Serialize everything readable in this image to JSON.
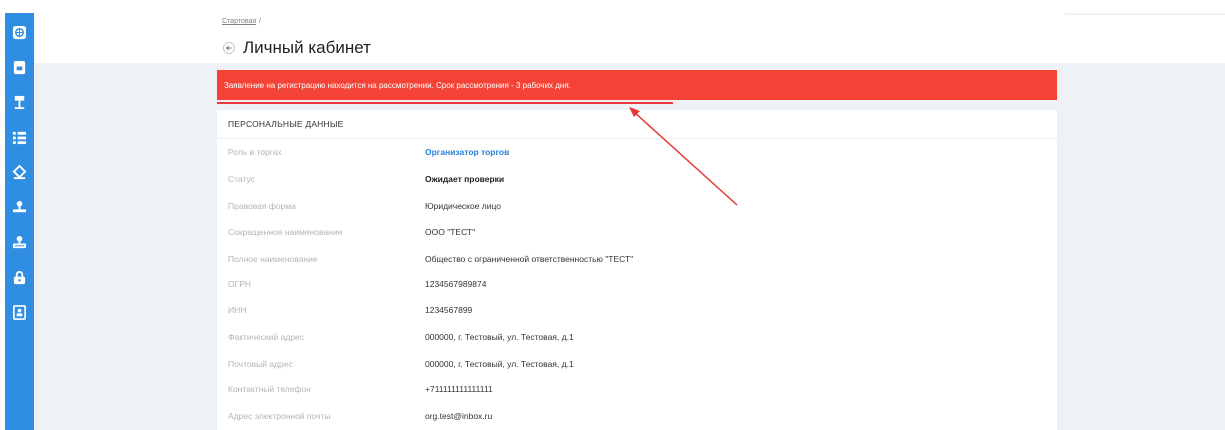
{
  "breadcrumb": {
    "home": "Стартовая",
    "separator": "/"
  },
  "page": {
    "title": "Личный кабинет"
  },
  "alert": {
    "text": "Заявление на регистрацию находится на рассмотрении. Срок рассмотрения - 3 рабочих дня.",
    "color": "#f44236"
  },
  "card": {
    "header": "ПЕРСОНАЛЬНЫЕ ДАННЫЕ",
    "rows": [
      {
        "label": "Роль в торгах",
        "value": "Организатор торгов"
      },
      {
        "label": "Статус",
        "value": "Ожидает проверки"
      },
      {
        "label": "Правовая форма",
        "value": "Юридическое лицо"
      },
      {
        "label": "Сокращенное наименование",
        "value": "ООО \"ТЕСТ\""
      },
      {
        "label": "Полное наименование",
        "value": "Общество с ограниченной ответственностью \"ТЕСТ\""
      },
      {
        "label": "ОГРН",
        "value": "1234567989874"
      },
      {
        "label": "ИНН",
        "value": "1234567899"
      },
      {
        "label": "Фактический адрес",
        "value": "000000, г. Тестовый, ул. Тестовая, д.1"
      },
      {
        "label": "Почтовый адрес",
        "value": "000000, г. Тестовый, ул. Тестовая, д.1"
      },
      {
        "label": "Контактный телефон",
        "value": "+711111111111111"
      },
      {
        "label": "Адрес электронной почты",
        "value": "org.test@inbox.ru"
      }
    ]
  },
  "sidebar": {
    "icons": [
      "globe-icon",
      "document-icon",
      "gavel-icon",
      "list-icon",
      "auction-icon",
      "stamp-icon",
      "stamp-alt-icon",
      "lock-icon",
      "contacts-icon"
    ]
  },
  "colors": {
    "sidebar": "#2f8ee2",
    "accent": "#2a7fd6",
    "background": "#eef1f6"
  }
}
